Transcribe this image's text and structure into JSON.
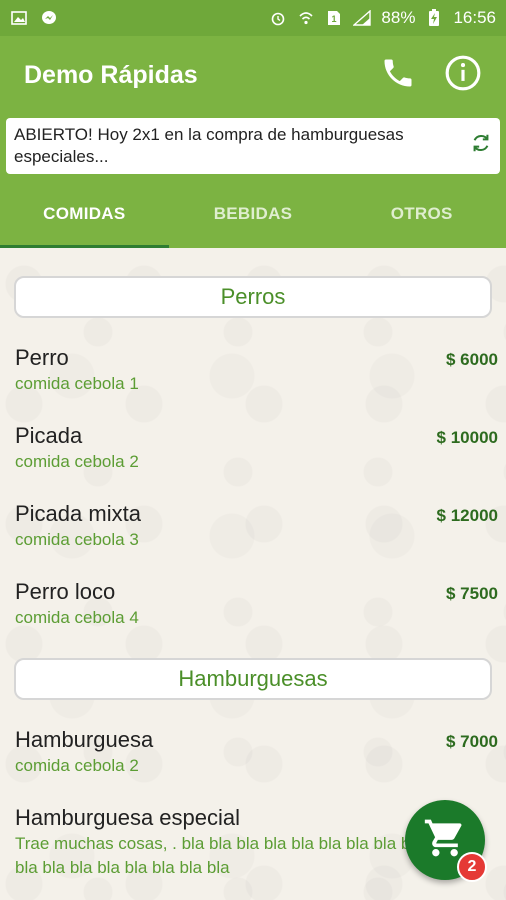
{
  "status_bar": {
    "battery": "88%",
    "time": "16:56",
    "left_icons": [
      "image-icon",
      "messenger-icon"
    ],
    "right_icons": [
      "alarm-icon",
      "wifi-icon",
      "sim-icon",
      "signal-icon",
      "battery-charging-icon"
    ]
  },
  "app_bar": {
    "title": "Demo Rápidas",
    "actions": [
      "phone-icon",
      "info-icon"
    ]
  },
  "notice": {
    "text": "ABIERTO! Hoy 2x1 en la compra de hamburguesas especiales...",
    "icon": "refresh-icon"
  },
  "tabs": [
    {
      "label": "COMIDAS",
      "active": true
    },
    {
      "label": "BEBIDAS",
      "active": false
    },
    {
      "label": "OTROS",
      "active": false
    }
  ],
  "sections": [
    {
      "title": "Perros",
      "items": [
        {
          "name": "Perro",
          "desc": "comida cebola 1",
          "price": "$ 6000"
        },
        {
          "name": "Picada",
          "desc": "comida cebola 2",
          "price": "$ 10000"
        },
        {
          "name": "Picada mixta",
          "desc": "comida cebola 3",
          "price": "$ 12000"
        },
        {
          "name": "Perro loco",
          "desc": "comida cebola 4",
          "price": "$ 7500"
        }
      ]
    },
    {
      "title": "Hamburguesas",
      "items": [
        {
          "name": "Hamburguesa",
          "desc": "comida cebola 2",
          "price": "$ 7000"
        },
        {
          "name": "Hamburguesa especial",
          "desc": "Trae muchas cosas, . bla bla bla bla bla bla bla bla bla bla bla bla bla bla bla bla bla bla bla",
          "price": ""
        }
      ]
    }
  ],
  "cart": {
    "icon": "cart-icon",
    "count": "2"
  },
  "colors": {
    "primary": "#7cb342",
    "dark": "#1b7a2a",
    "accent": "#5c9d34",
    "badge": "#e53935"
  }
}
